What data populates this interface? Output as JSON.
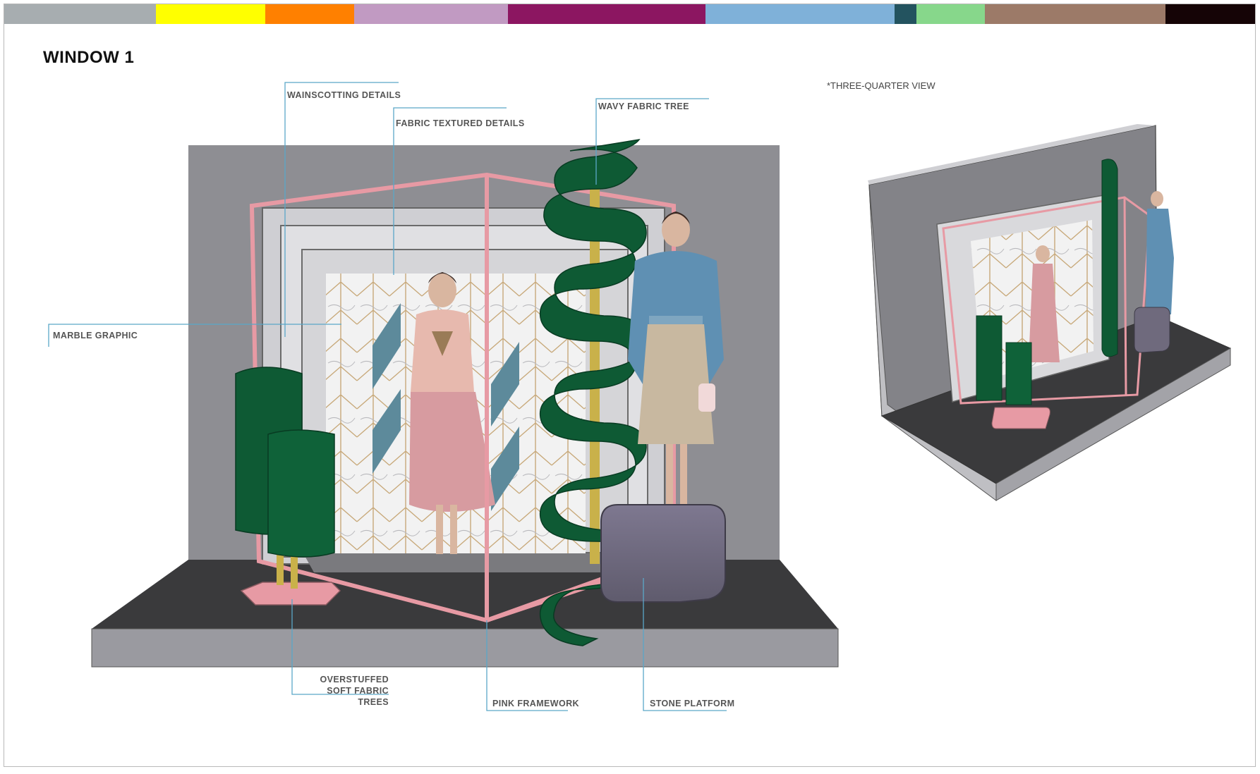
{
  "title": "WINDOW 1",
  "view_note": "*THREE-QUARTER VIEW",
  "color_bar": [
    {
      "name": "grey",
      "color": "#a7adb0",
      "weight": 215
    },
    {
      "name": "yellow",
      "color": "#ffff00",
      "weight": 155
    },
    {
      "name": "orange",
      "color": "#ff8000",
      "weight": 126
    },
    {
      "name": "lilac",
      "color": "#c19ac2",
      "weight": 218
    },
    {
      "name": "magenta",
      "color": "#8c1661",
      "weight": 280
    },
    {
      "name": "sky-blue",
      "color": "#7fb1d9",
      "weight": 268
    },
    {
      "name": "teal",
      "color": "#23535f",
      "weight": 31
    },
    {
      "name": "mint",
      "color": "#87d78b",
      "weight": 97
    },
    {
      "name": "taupe",
      "color": "#9c7a68",
      "weight": 256
    },
    {
      "name": "black",
      "color": "#150406",
      "weight": 127
    }
  ],
  "callouts": {
    "wainscotting": "WAINSCOTTING DETAILS",
    "fabric_textured": "FABRIC TEXTURED DETAILS",
    "wavy_tree": "WAVY FABRIC TREE",
    "marble": "MARBLE GRAPHIC",
    "overstuffed_1": "OVERSTUFFED",
    "overstuffed_2": "SOFT FABRIC TREES",
    "pink_framework": "PINK FRAMEWORK",
    "stone_platform": "STONE  PLATFORM"
  },
  "palette": {
    "wall": "#8e8e93",
    "floor": "#3a3a3c",
    "plinth": "#9a9aa0",
    "pink": "#e79aa4",
    "green": "#0e5a34",
    "gold": "#c9b14a",
    "stone": "#6f6a7d",
    "callout_line": "#5aa7c8"
  }
}
